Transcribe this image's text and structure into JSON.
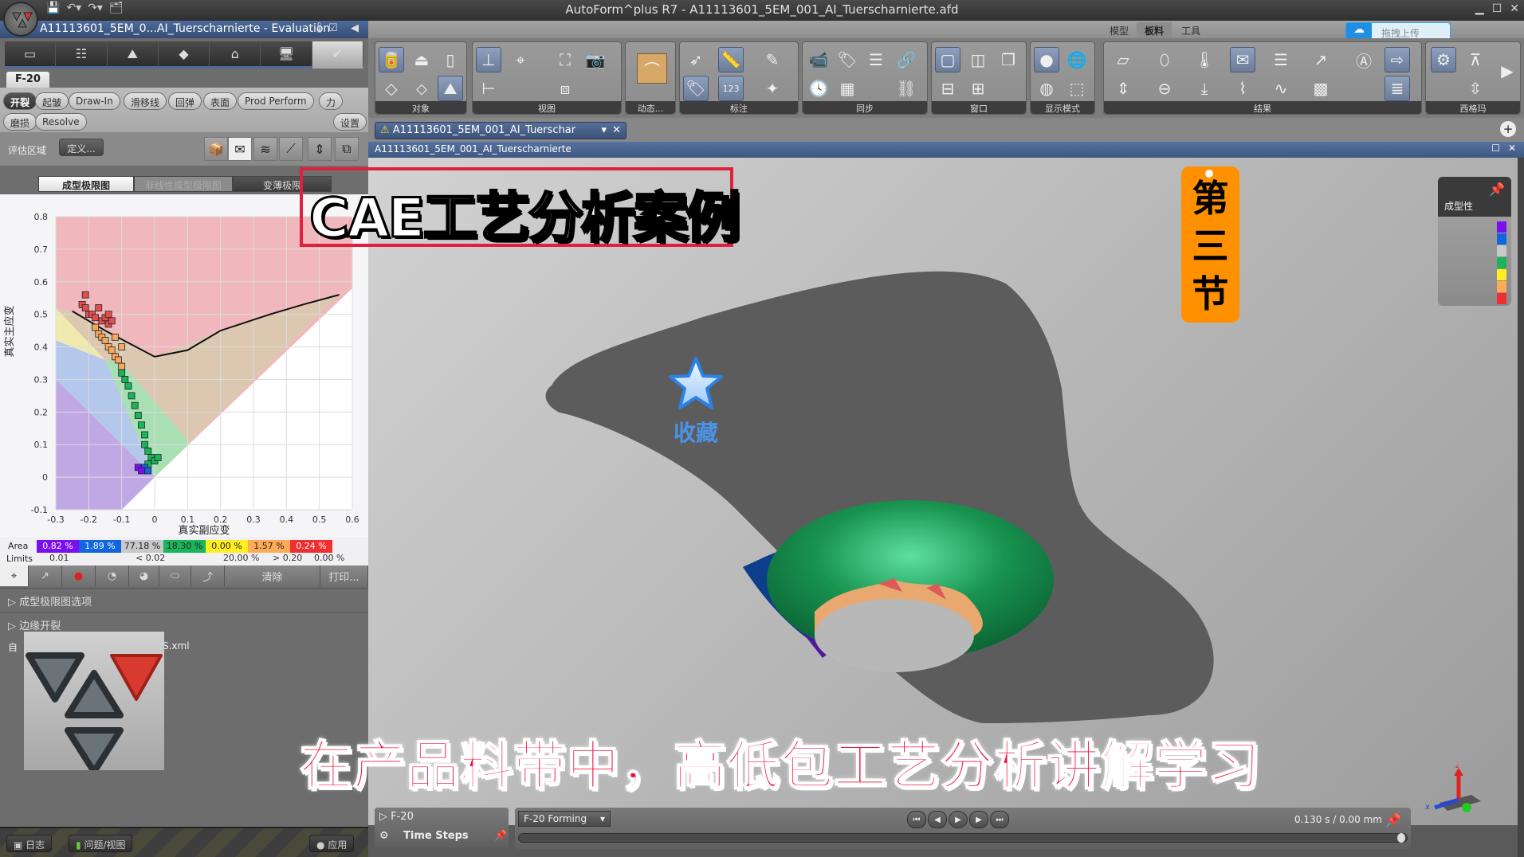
{
  "window": {
    "title": "AutoForm^plus R7 - A11113601_5EM_001_AI_Tuerscharnierte.afd",
    "controls": [
      "minimize",
      "maximize",
      "close"
    ]
  },
  "left_panel": {
    "header_title": "A11113601_5EM_0...AI_Tuerscharnierte - Evaluation",
    "process_steps": [
      "part-icon",
      "process-plan-icon",
      "die-face-icon",
      "blank-icon",
      "tool-icon",
      "computer-icon",
      "evaluation-icon"
    ],
    "process_tab": "F-20",
    "pills_row1": [
      "开裂",
      "起皱",
      "Draw-In",
      "滑移线",
      "回弹",
      "表面",
      "Prod Perform",
      "力"
    ],
    "pills_row2": [
      "磨损",
      "Resolve"
    ],
    "settings_label": "设置",
    "eval_area_label": "评估区域",
    "define_button": "定义...",
    "chart_tabs": [
      "成型极限图",
      "非线性成型极限图",
      "变薄极限"
    ],
    "active_chart_tab": "成型极限图",
    "legend": {
      "area_label": "Area",
      "limits_label": "Limits",
      "cells": [
        {
          "value": "0.82 %",
          "color": "#7a10f0"
        },
        {
          "value": "1.89 %",
          "color": "#1066e0"
        },
        {
          "value": "77.18 %",
          "color": "#c8c8c8"
        },
        {
          "value": "18.30 %",
          "color": "#1ab55a"
        },
        {
          "value": "0.00 %",
          "color": "#ffee22"
        },
        {
          "value": "1.57 %",
          "color": "#ffaa55"
        },
        {
          "value": "0.24 %",
          "color": "#f03030"
        }
      ],
      "limits": [
        "0.01",
        "< 0.02",
        "20.00 %",
        "> 0.20",
        "0.00 %"
      ]
    },
    "tool_buttons": [
      "select-point-icon",
      "select-curve-icon",
      "select-red-icon",
      "select-area-icon",
      "select-region-icon",
      "select-oval-icon",
      "path-icon"
    ],
    "clear_button": "清除",
    "print_button": "打印...",
    "accordions": [
      "成型极限图选项",
      "边缘开裂"
    ],
    "auto_label": "自",
    "xml_file": "S.xml",
    "bottom_buttons": {
      "log": "日志",
      "issues": "问题/视图",
      "apply": "应用"
    }
  },
  "chart_data": {
    "type": "scatter",
    "title": "成型极限图",
    "xlabel": "真实副应变",
    "ylabel": "真实主应变",
    "xlim": [
      -0.3,
      0.6
    ],
    "ylim": [
      -0.1,
      0.8
    ],
    "xticks": [
      -0.3,
      -0.2,
      -0.1,
      0,
      0.1,
      0.2,
      0.3,
      0.4,
      0.5,
      0.6
    ],
    "yticks": [
      -0.1,
      0,
      0.1,
      0.2,
      0.3,
      0.4,
      0.5,
      0.6,
      0.7,
      0.8
    ],
    "grid": true,
    "flc_curve": [
      [
        -0.25,
        0.51
      ],
      [
        -0.15,
        0.45
      ],
      [
        0,
        0.37
      ],
      [
        0.1,
        0.39
      ],
      [
        0.2,
        0.45
      ],
      [
        0.35,
        0.5
      ],
      [
        0.45,
        0.53
      ],
      [
        0.56,
        0.56
      ]
    ],
    "zones": [
      {
        "name": "crack",
        "color": "#f0b8bc"
      },
      {
        "name": "risk",
        "color": "#f0c8a0"
      },
      {
        "name": "safe",
        "color": "#dcc8b0"
      },
      {
        "name": "insufficient-stretch",
        "color": "#a8e0b4"
      },
      {
        "name": "wrinkle-tendency",
        "color": "#f0eab0"
      },
      {
        "name": "wrinkle",
        "color": "#b4c8ec"
      },
      {
        "name": "thickening",
        "color": "#c0a8e4"
      }
    ],
    "series": [
      {
        "name": "crack",
        "color": "#e05050",
        "points": [
          [
            -0.21,
            0.56
          ],
          [
            -0.22,
            0.53
          ],
          [
            -0.21,
            0.52
          ],
          [
            -0.2,
            0.5
          ],
          [
            -0.19,
            0.5
          ],
          [
            -0.18,
            0.49
          ],
          [
            -0.17,
            0.52
          ],
          [
            -0.16,
            0.48
          ],
          [
            -0.15,
            0.49
          ],
          [
            -0.14,
            0.5
          ],
          [
            -0.14,
            0.47
          ],
          [
            -0.13,
            0.48
          ]
        ]
      },
      {
        "name": "risk",
        "color": "#f5a860",
        "points": [
          [
            -0.18,
            0.46
          ],
          [
            -0.17,
            0.44
          ],
          [
            -0.16,
            0.43
          ],
          [
            -0.15,
            0.42
          ],
          [
            -0.14,
            0.4
          ],
          [
            -0.13,
            0.39
          ],
          [
            -0.12,
            0.37
          ],
          [
            -0.11,
            0.36
          ],
          [
            -0.1,
            0.34
          ],
          [
            -0.12,
            0.43
          ],
          [
            -0.1,
            0.4
          ]
        ]
      },
      {
        "name": "safe",
        "color": "#1ab55a",
        "points": [
          [
            -0.1,
            0.32
          ],
          [
            -0.09,
            0.3
          ],
          [
            -0.08,
            0.28
          ],
          [
            -0.07,
            0.25
          ],
          [
            -0.06,
            0.22
          ],
          [
            -0.05,
            0.19
          ],
          [
            -0.04,
            0.16
          ],
          [
            -0.03,
            0.13
          ],
          [
            -0.03,
            0.1
          ],
          [
            -0.02,
            0.08
          ],
          [
            -0.01,
            0.06
          ],
          [
            0,
            0.05
          ],
          [
            0.01,
            0.06
          ],
          [
            -0.02,
            0.04
          ]
        ]
      },
      {
        "name": "wrinkle",
        "color": "#1066e0",
        "points": [
          [
            -0.03,
            0.03
          ],
          [
            -0.02,
            0.02
          ]
        ]
      },
      {
        "name": "thickening",
        "color": "#7a10f0",
        "points": [
          [
            -0.05,
            0.03
          ],
          [
            -0.04,
            0.02
          ]
        ]
      }
    ]
  },
  "ribbon": {
    "tabs": [
      "模型",
      "板料",
      "工具"
    ],
    "active_tab": "板料",
    "groups": [
      {
        "label": "对象"
      },
      {
        "label": "视图"
      },
      {
        "label": "动态..."
      },
      {
        "label": "标注"
      },
      {
        "label": "同步"
      },
      {
        "label": "窗口"
      },
      {
        "label": "显示模式"
      },
      {
        "label": "结果"
      },
      {
        "label": "西格玛"
      }
    ],
    "cloud_upload_label": "拖拽上传"
  },
  "document": {
    "tab_title": "A11113601_5EM_001_AI_Tuerschar",
    "view_title": "A11113601_5EM_001_AI_Tuerscharnierte"
  },
  "result_legend": {
    "title": "成型性",
    "colors": [
      "#7a10f0",
      "#1066e0",
      "#c8c8c8",
      "#1ab55a",
      "#ffee22",
      "#ffaa55",
      "#f03030"
    ]
  },
  "overlays": {
    "caption_title": "CAE工艺分析案例",
    "section_chars": [
      "第",
      "三",
      "节"
    ],
    "favorite_label": "收藏",
    "subtitle": "在产品料带中，高低包工艺分析讲解学习"
  },
  "timeline": {
    "process": "F-20",
    "time_steps_label": "Time Steps",
    "stage_select": "F-20 Forming",
    "readout": "0.130 s / 0.00 mm",
    "progress": 1.0
  },
  "axis_triad": {
    "x": "x",
    "z": "z"
  }
}
